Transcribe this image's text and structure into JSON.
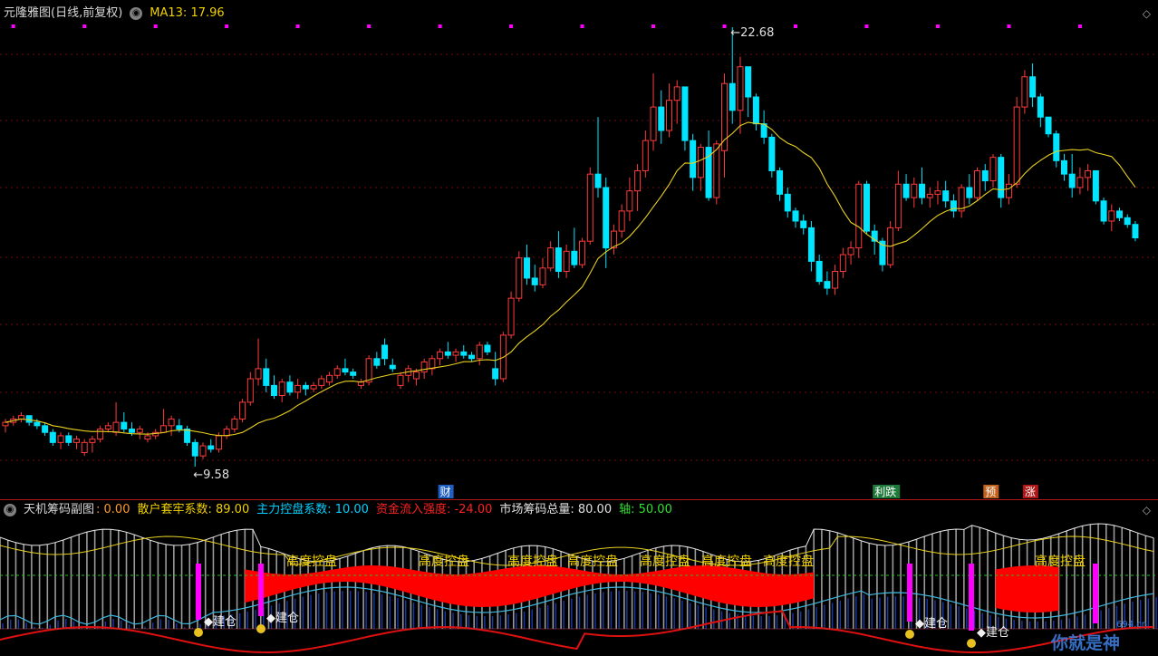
{
  "header": {
    "title": "元隆雅图(日线,前复权)",
    "ma_label": "MA13: 17.96"
  },
  "sub_header": {
    "title": "天机筹码副图",
    "value0": ": 0.00",
    "item1": "散户套牢系数: 89.00",
    "item2": "主力控盘系数: 10.00",
    "item3": "资金流入强度: -24.00",
    "item4": "市场筹码总量: 80.00",
    "item5": "轴: 50.00"
  },
  "colors": {
    "up": "#ff3b3b",
    "down": "#00e5ff",
    "ma": "#e8d020",
    "magenta": "#ff00ff",
    "yellow_text": "#f0d000",
    "cyan_text": "#00d0ff",
    "red_text": "#ff2020",
    "green_text": "#30e030"
  },
  "chart_data": [
    {
      "type": "candlestick",
      "series_name": "元隆雅图(日线,前复权)",
      "ma_name": "MA13",
      "high_label": "22.68",
      "low_label": "9.58",
      "event_labels": [
        "财",
        "利跌",
        "预",
        "涨"
      ],
      "candles": [
        [
          10.8,
          11.0,
          10.6,
          10.9
        ],
        [
          10.9,
          11.1,
          10.8,
          11.0
        ],
        [
          11.0,
          11.2,
          10.9,
          11.1
        ],
        [
          11.1,
          11.0,
          10.8,
          10.9
        ],
        [
          10.9,
          11.0,
          10.7,
          10.8
        ],
        [
          10.8,
          10.9,
          10.5,
          10.6
        ],
        [
          10.6,
          10.7,
          10.2,
          10.3
        ],
        [
          10.3,
          10.6,
          10.1,
          10.5
        ],
        [
          10.5,
          10.6,
          10.2,
          10.3
        ],
        [
          10.3,
          10.5,
          10.1,
          10.4
        ],
        [
          10.0,
          10.4,
          9.9,
          10.3
        ],
        [
          10.3,
          10.5,
          10.0,
          10.4
        ],
        [
          10.4,
          10.8,
          10.3,
          10.7
        ],
        [
          10.7,
          10.9,
          10.6,
          10.8
        ],
        [
          10.6,
          11.5,
          10.5,
          10.9
        ],
        [
          10.9,
          11.2,
          10.6,
          10.7
        ],
        [
          10.7,
          10.9,
          10.5,
          10.6
        ],
        [
          10.6,
          10.8,
          10.4,
          10.7
        ],
        [
          10.4,
          10.6,
          10.3,
          10.5
        ],
        [
          10.5,
          10.7,
          10.4,
          10.6
        ],
        [
          10.6,
          11.3,
          10.6,
          10.8
        ],
        [
          10.8,
          11.1,
          10.5,
          11.0
        ],
        [
          10.8,
          11.0,
          10.6,
          10.7
        ],
        [
          10.7,
          10.8,
          10.2,
          10.3
        ],
        [
          10.3,
          10.4,
          9.58,
          9.9
        ],
        [
          9.9,
          10.3,
          9.8,
          10.2
        ],
        [
          10.2,
          10.4,
          10.0,
          10.1
        ],
        [
          10.1,
          10.6,
          10.0,
          10.5
        ],
        [
          10.5,
          10.8,
          10.4,
          10.7
        ],
        [
          10.7,
          11.1,
          10.6,
          11.0
        ],
        [
          11.0,
          11.6,
          10.9,
          11.5
        ],
        [
          11.5,
          12.4,
          11.4,
          12.2
        ],
        [
          12.2,
          13.4,
          12.0,
          12.5
        ],
        [
          12.5,
          12.8,
          11.8,
          12.0
        ],
        [
          12.0,
          12.3,
          11.6,
          11.7
        ],
        [
          11.7,
          12.2,
          11.5,
          12.1
        ],
        [
          12.1,
          12.3,
          11.7,
          11.8
        ],
        [
          11.8,
          12.2,
          11.6,
          12.0
        ],
        [
          12.0,
          12.1,
          11.7,
          11.9
        ],
        [
          11.9,
          12.1,
          11.8,
          12.0
        ],
        [
          12.0,
          12.3,
          11.9,
          12.2
        ],
        [
          12.1,
          12.4,
          12.0,
          12.3
        ],
        [
          12.3,
          12.6,
          12.2,
          12.5
        ],
        [
          12.5,
          12.8,
          12.3,
          12.4
        ],
        [
          12.4,
          12.5,
          12.2,
          12.3
        ],
        [
          12.0,
          12.2,
          11.9,
          12.1
        ],
        [
          12.1,
          12.9,
          12.0,
          12.8
        ],
        [
          12.8,
          13.0,
          12.5,
          12.6
        ],
        [
          13.2,
          13.4,
          12.6,
          12.8
        ],
        [
          12.6,
          12.8,
          12.4,
          12.5
        ],
        [
          12.0,
          12.4,
          11.9,
          12.3
        ],
        [
          12.3,
          12.6,
          12.1,
          12.5
        ],
        [
          12.2,
          12.5,
          12.0,
          12.4
        ],
        [
          12.4,
          12.8,
          12.2,
          12.7
        ],
        [
          12.5,
          12.9,
          12.3,
          12.8
        ],
        [
          12.8,
          13.1,
          12.6,
          13.0
        ],
        [
          13.0,
          13.3,
          12.8,
          12.9
        ],
        [
          12.9,
          13.1,
          12.7,
          13.0
        ],
        [
          13.0,
          13.2,
          12.8,
          12.9
        ],
        [
          12.9,
          13.0,
          12.7,
          12.8
        ],
        [
          12.8,
          13.3,
          12.6,
          13.2
        ],
        [
          13.2,
          13.3,
          12.9,
          13.0
        ],
        [
          12.5,
          13.0,
          12.0,
          12.2
        ],
        [
          12.2,
          13.6,
          12.1,
          13.5
        ],
        [
          13.5,
          14.8,
          13.4,
          14.6
        ],
        [
          14.6,
          16.0,
          14.5,
          15.8
        ],
        [
          15.8,
          16.2,
          15.0,
          15.2
        ],
        [
          15.2,
          15.6,
          14.8,
          15.0
        ],
        [
          15.0,
          15.8,
          14.9,
          15.5
        ],
        [
          15.5,
          16.3,
          15.4,
          16.1
        ],
        [
          16.1,
          16.6,
          15.2,
          15.4
        ],
        [
          15.4,
          16.2,
          15.2,
          16.0
        ],
        [
          16.0,
          16.7,
          15.5,
          15.6
        ],
        [
          15.6,
          16.4,
          15.5,
          16.3
        ],
        [
          16.3,
          18.5,
          16.2,
          18.3
        ],
        [
          18.3,
          20.0,
          17.6,
          17.9
        ],
        [
          17.9,
          18.2,
          15.5,
          16.1
        ],
        [
          16.1,
          16.8,
          15.9,
          16.6
        ],
        [
          16.6,
          17.4,
          16.4,
          17.2
        ],
        [
          17.2,
          18.2,
          16.9,
          17.8
        ],
        [
          17.8,
          18.6,
          17.2,
          18.4
        ],
        [
          18.4,
          19.6,
          18.2,
          19.3
        ],
        [
          19.3,
          21.3,
          19.0,
          20.3
        ],
        [
          20.3,
          20.8,
          19.2,
          19.6
        ],
        [
          19.6,
          21.0,
          19.4,
          20.5
        ],
        [
          20.5,
          21.1,
          19.8,
          20.9
        ],
        [
          20.9,
          19.8,
          19.0,
          19.3
        ],
        [
          19.3,
          19.5,
          17.8,
          18.2
        ],
        [
          18.2,
          19.2,
          17.8,
          19.1
        ],
        [
          19.1,
          19.6,
          17.5,
          17.6
        ],
        [
          17.6,
          19.3,
          17.4,
          19.2
        ],
        [
          19.0,
          21.3,
          18.2,
          21.0
        ],
        [
          21.0,
          22.68,
          19.8,
          20.2
        ],
        [
          20.2,
          21.8,
          19.5,
          21.5
        ],
        [
          21.5,
          20.9,
          20.0,
          20.6
        ],
        [
          20.6,
          20.7,
          19.6,
          19.8
        ],
        [
          19.8,
          20.2,
          19.2,
          19.4
        ],
        [
          19.4,
          19.5,
          18.2,
          18.4
        ],
        [
          18.4,
          18.5,
          17.5,
          17.7
        ],
        [
          17.7,
          17.9,
          17.0,
          17.2
        ],
        [
          17.2,
          17.3,
          16.7,
          16.9
        ],
        [
          16.9,
          17.1,
          16.5,
          16.7
        ],
        [
          16.7,
          16.9,
          15.4,
          15.7
        ],
        [
          15.7,
          15.9,
          15.0,
          15.1
        ],
        [
          15.1,
          15.4,
          14.7,
          14.9
        ],
        [
          14.9,
          15.6,
          14.7,
          15.4
        ],
        [
          15.4,
          16.1,
          15.2,
          15.9
        ],
        [
          15.9,
          16.3,
          15.6,
          16.1
        ],
        [
          16.1,
          18.1,
          15.8,
          18.0
        ],
        [
          18.0,
          18.1,
          16.5,
          16.6
        ],
        [
          16.6,
          16.8,
          15.9,
          16.3
        ],
        [
          16.3,
          16.4,
          15.4,
          15.6
        ],
        [
          15.6,
          16.9,
          15.5,
          16.7
        ],
        [
          16.7,
          18.4,
          16.6,
          18.0
        ],
        [
          18.0,
          18.3,
          17.5,
          17.6
        ],
        [
          17.6,
          18.2,
          17.3,
          18.0
        ],
        [
          18.0,
          18.5,
          17.4,
          17.6
        ],
        [
          17.6,
          17.9,
          17.3,
          17.7
        ],
        [
          17.7,
          18.1,
          17.4,
          17.8
        ],
        [
          17.8,
          18.1,
          17.3,
          17.5
        ],
        [
          17.5,
          17.7,
          17.0,
          17.2
        ],
        [
          17.2,
          18.0,
          17.0,
          17.9
        ],
        [
          17.9,
          18.3,
          17.4,
          17.6
        ],
        [
          17.6,
          18.5,
          17.5,
          18.4
        ],
        [
          18.4,
          18.6,
          17.8,
          18.1
        ],
        [
          18.1,
          18.9,
          17.9,
          18.8
        ],
        [
          18.8,
          18.9,
          17.3,
          17.6
        ],
        [
          17.6,
          18.3,
          17.4,
          18.0
        ],
        [
          18.0,
          20.6,
          17.9,
          20.3
        ],
        [
          20.3,
          21.4,
          20.1,
          21.2
        ],
        [
          21.2,
          21.6,
          20.3,
          20.6
        ],
        [
          20.6,
          20.7,
          19.7,
          20.0
        ],
        [
          20.0,
          19.7,
          19.4,
          19.5
        ],
        [
          19.5,
          19.6,
          18.5,
          18.7
        ],
        [
          18.7,
          18.9,
          18.1,
          18.3
        ],
        [
          18.3,
          18.9,
          17.6,
          17.9
        ],
        [
          17.9,
          18.5,
          17.7,
          18.2
        ],
        [
          18.2,
          18.6,
          17.8,
          18.4
        ],
        [
          18.4,
          18.4,
          17.4,
          17.5
        ],
        [
          17.5,
          17.6,
          16.8,
          16.9
        ],
        [
          16.9,
          17.4,
          16.6,
          17.2
        ],
        [
          17.2,
          17.3,
          16.9,
          17.0
        ],
        [
          17.0,
          17.1,
          16.7,
          16.8
        ],
        [
          16.8,
          16.9,
          16.3,
          16.4
        ]
      ]
    },
    {
      "type": "indicator",
      "title": "天机筹码副图",
      "series": [
        {
          "name": "散户套牢系数",
          "value": 89.0
        },
        {
          "name": "主力控盘系数",
          "value": 10.0
        },
        {
          "name": "资金流入强度",
          "value": -24.0
        },
        {
          "name": "市场筹码总量",
          "value": 80.0
        },
        {
          "name": "轴",
          "value": 50.0
        }
      ],
      "annotations": {
        "control": [
          "高度控盘",
          "高度控盘",
          "高度控盘",
          "高度控盘",
          "高度控盘",
          "高度控盘",
          "高度控盘",
          "高度控盘"
        ],
        "build": [
          "建仓",
          "建仓",
          "建仓",
          "建仓"
        ]
      }
    }
  ],
  "watermark": {
    "text": "你就是神",
    "site": "694.cn"
  }
}
